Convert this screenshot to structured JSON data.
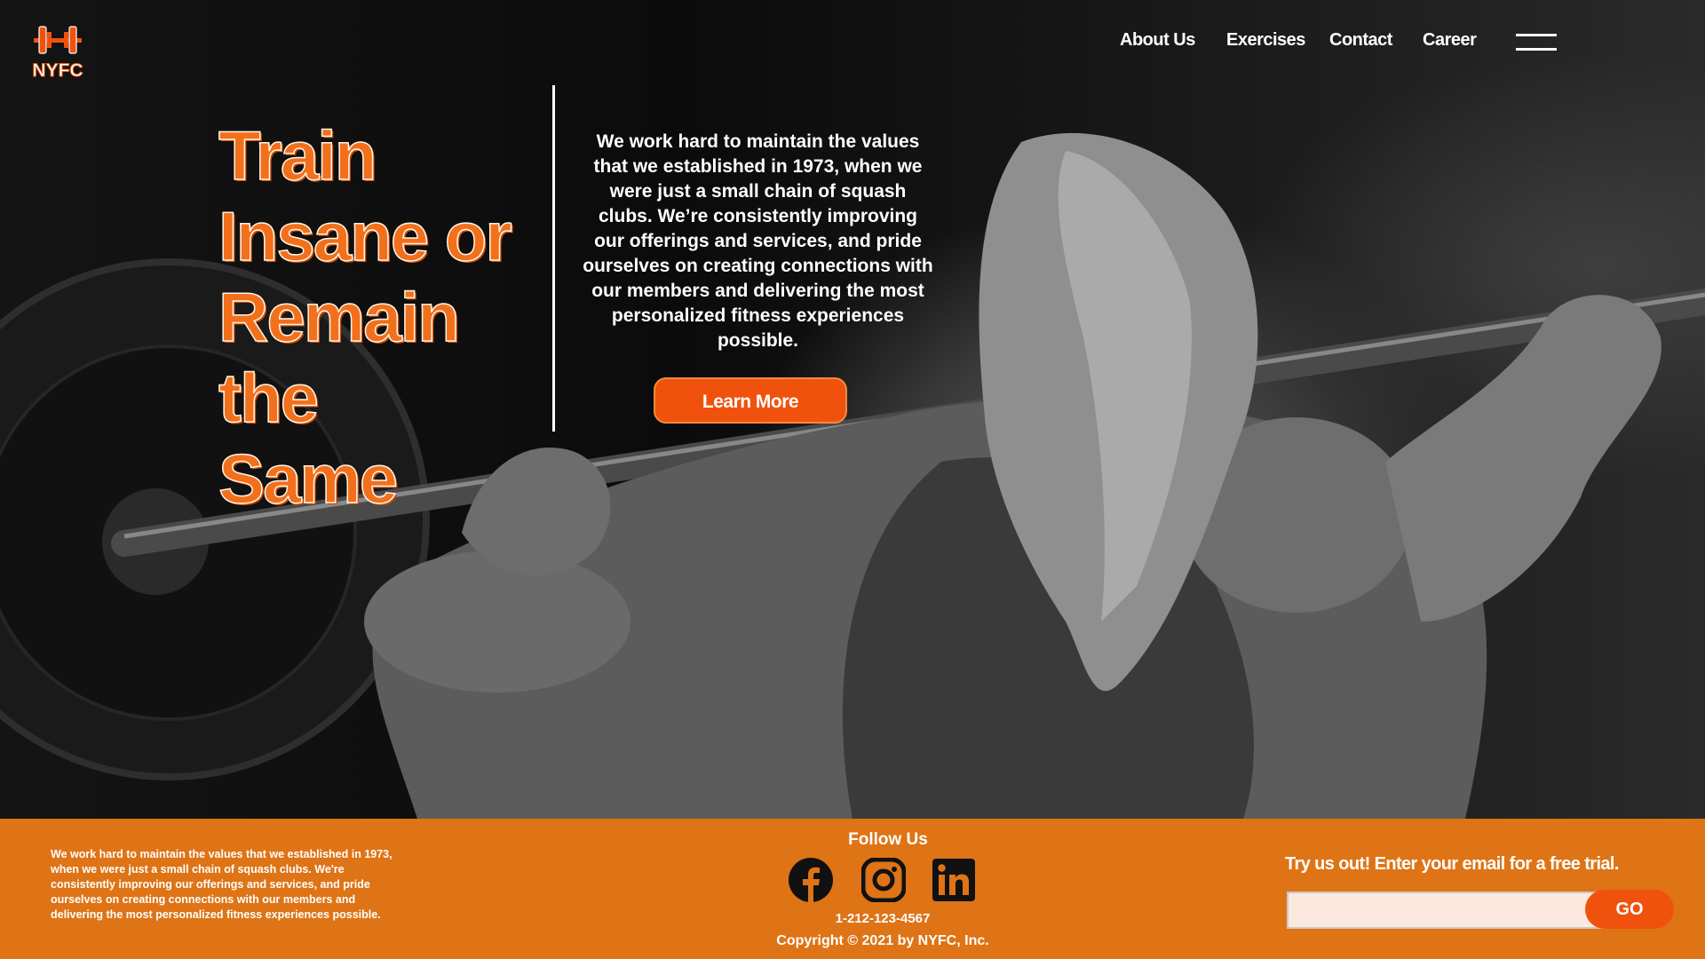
{
  "brand": {
    "logo_text": "NYFC"
  },
  "nav": {
    "items": [
      {
        "label": "About Us"
      },
      {
        "label": "Exercises"
      },
      {
        "label": "Contact"
      },
      {
        "label": "Career"
      }
    ],
    "menu_icon": "hamburger-menu-icon"
  },
  "hero": {
    "headline_lines": [
      "Train",
      "Insane or",
      "Remain",
      "the Same"
    ],
    "intro": "We work hard to maintain the values that we established in 1973, when we were just a small chain of squash clubs. We’re consistently improving our offerings and services, and pride ourselves on creating connections with our members and delivering the most personalized fitness experiences possible.",
    "cta_label": "Learn More"
  },
  "footer": {
    "about_text": "We work hard to maintain the values that we established in 1973, when we were just a small chain of squash clubs. We're consistently improving our offerings and services, and pride ourselves on creating connections with our members and delivering the most personalized fitness experiences possible.",
    "follow_label": "Follow Us",
    "social": [
      {
        "icon": "facebook-icon"
      },
      {
        "icon": "instagram-icon"
      },
      {
        "icon": "linkedin-icon"
      }
    ],
    "phone": "1-212-123-4567",
    "copyright": "Copyright © 2021 by NYFC, Inc.",
    "trial_label": "Try us out! Enter your email for a free trial.",
    "email_value": "",
    "go_label": "GO"
  },
  "colors": {
    "accent": "#f0520e",
    "headline": "#f2701c",
    "footer_bg": "#de7416"
  }
}
